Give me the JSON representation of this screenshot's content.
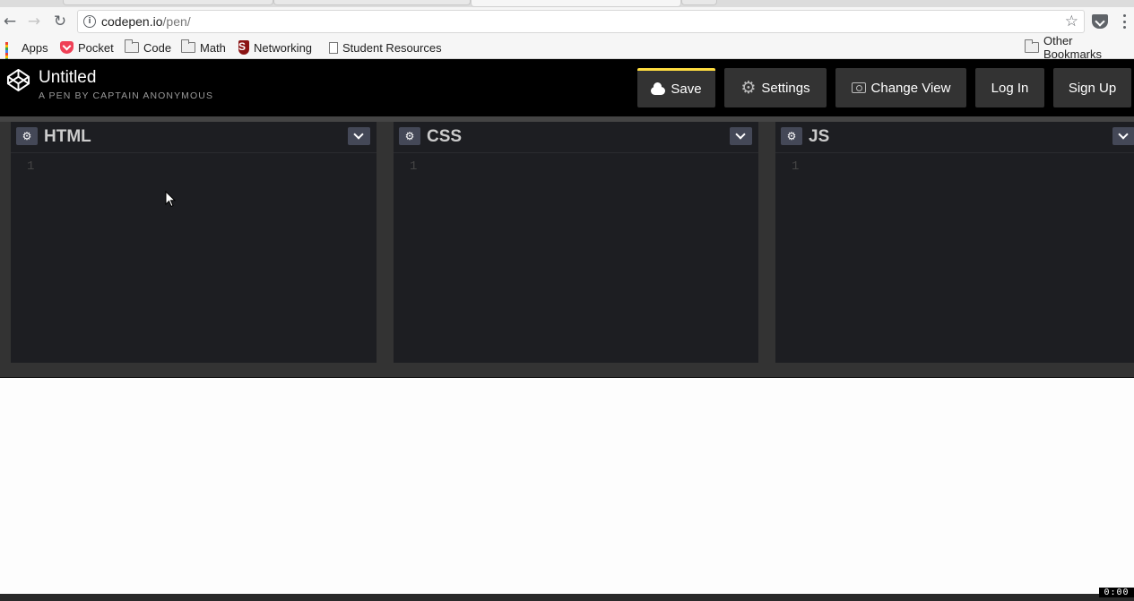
{
  "browser": {
    "url_host": "codepen.io",
    "url_path": "/pen/",
    "bookmarks": [
      {
        "label": "Apps",
        "icon": "apps-grid-icon"
      },
      {
        "label": "Pocket",
        "icon": "pocket-icon"
      },
      {
        "label": "Code",
        "icon": "folder-icon"
      },
      {
        "label": "Math",
        "icon": "folder-icon"
      },
      {
        "label": "Networking",
        "icon": "networking-s-icon"
      },
      {
        "label": "Student Resources",
        "icon": "page-icon"
      }
    ],
    "other_bookmarks": "Other Bookmarks"
  },
  "codepen": {
    "title": "Untitled",
    "subtitle": "A PEN BY CAPTAIN ANONYMOUS",
    "buttons": {
      "save": "Save",
      "settings": "Settings",
      "change_view": "Change View",
      "log_in": "Log In",
      "sign_up": "Sign Up"
    },
    "accent_color": "#ffdd40",
    "panels": [
      {
        "name": "HTML",
        "line": "1"
      },
      {
        "name": "CSS",
        "line": "1"
      },
      {
        "name": "JS",
        "line": "1"
      }
    ]
  },
  "recorder_badge": "0:00"
}
